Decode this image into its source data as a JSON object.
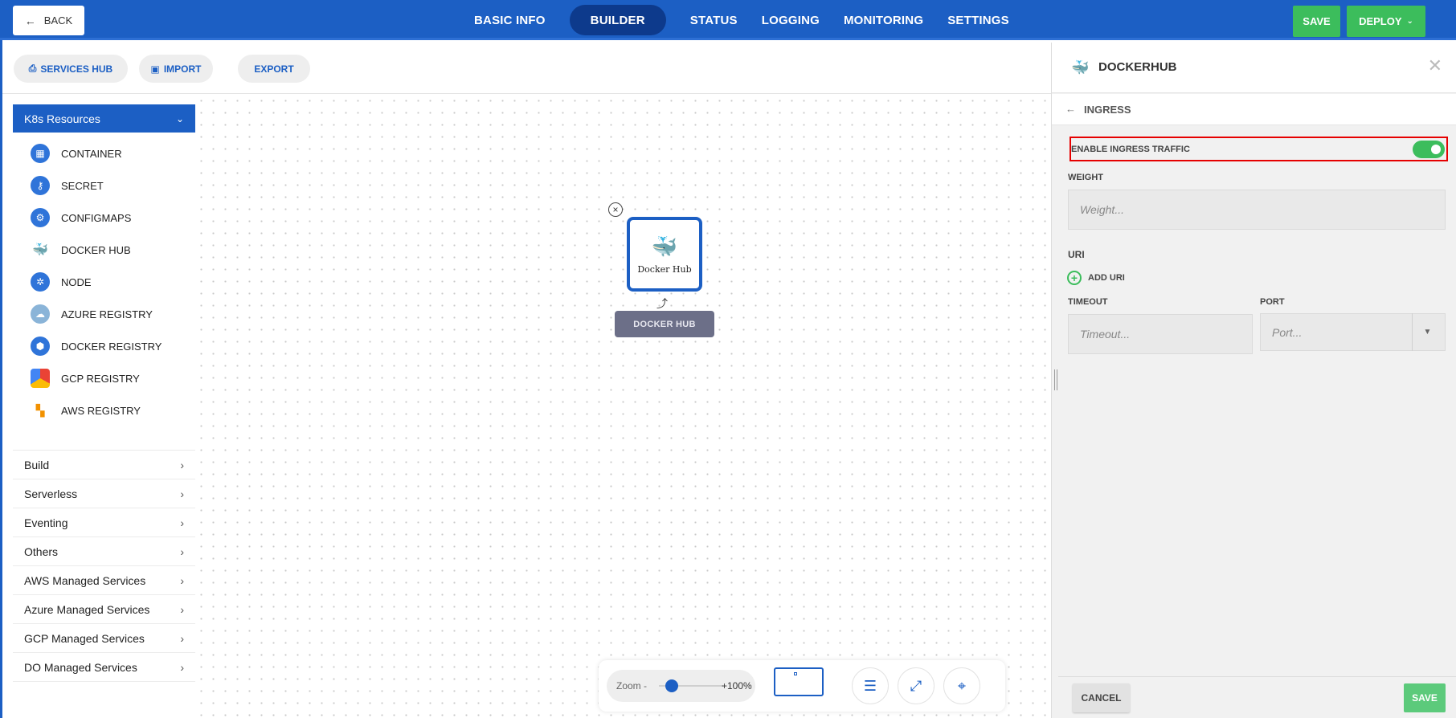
{
  "topbar": {
    "back_label": "BACK",
    "tabs": [
      "BASIC INFO",
      "BUILDER",
      "STATUS",
      "LOGGING",
      "MONITORING",
      "SETTINGS"
    ],
    "active_tab": "BUILDER",
    "save_label": "SAVE",
    "deploy_label": "DEPLOY",
    "accent_color": "#1c5fc4",
    "green_color": "#3cbd5c"
  },
  "toolbar": {
    "services_hub_label": "SERVICES HUB",
    "import_label": "IMPORT",
    "export_label": "EXPORT"
  },
  "sidebar": {
    "k8s_header": "K8s Resources",
    "k8s_items": [
      {
        "label": "CONTAINER",
        "icon": "container-icon"
      },
      {
        "label": "SECRET",
        "icon": "key-icon"
      },
      {
        "label": "CONFIGMAPS",
        "icon": "configmap-icon"
      },
      {
        "label": "DOCKER HUB",
        "icon": "docker-icon"
      },
      {
        "label": "NODE",
        "icon": "node-icon"
      },
      {
        "label": "AZURE REGISTRY",
        "icon": "azure-registry-icon"
      },
      {
        "label": "DOCKER REGISTRY",
        "icon": "docker-registry-icon"
      },
      {
        "label": "GCP REGISTRY",
        "icon": "gcp-registry-icon"
      },
      {
        "label": "AWS REGISTRY",
        "icon": "aws-registry-icon"
      }
    ],
    "categories": [
      "Build",
      "Serverless",
      "Eventing",
      "Others",
      "AWS Managed Services",
      "Azure Managed Services",
      "GCP Managed Services",
      "DO Managed Services"
    ]
  },
  "canvas": {
    "node_label": "Docker Hub",
    "node_tag": "DOCKER HUB"
  },
  "zoom": {
    "label": "Zoom -",
    "value": "+100%"
  },
  "panel": {
    "title": "DOCKERHUB",
    "section": "INGRESS",
    "enable_ingress_label": "ENABLE INGRESS TRAFFIC",
    "enable_ingress_on": true,
    "weight_label": "WEIGHT",
    "weight_placeholder": "Weight...",
    "uri_label": "URI",
    "add_uri_label": "ADD URI",
    "timeout_label": "TIMEOUT",
    "timeout_placeholder": "Timeout...",
    "port_label": "PORT",
    "port_placeholder": "Port...",
    "cancel_label": "CANCEL",
    "save_label": "SAVE"
  }
}
